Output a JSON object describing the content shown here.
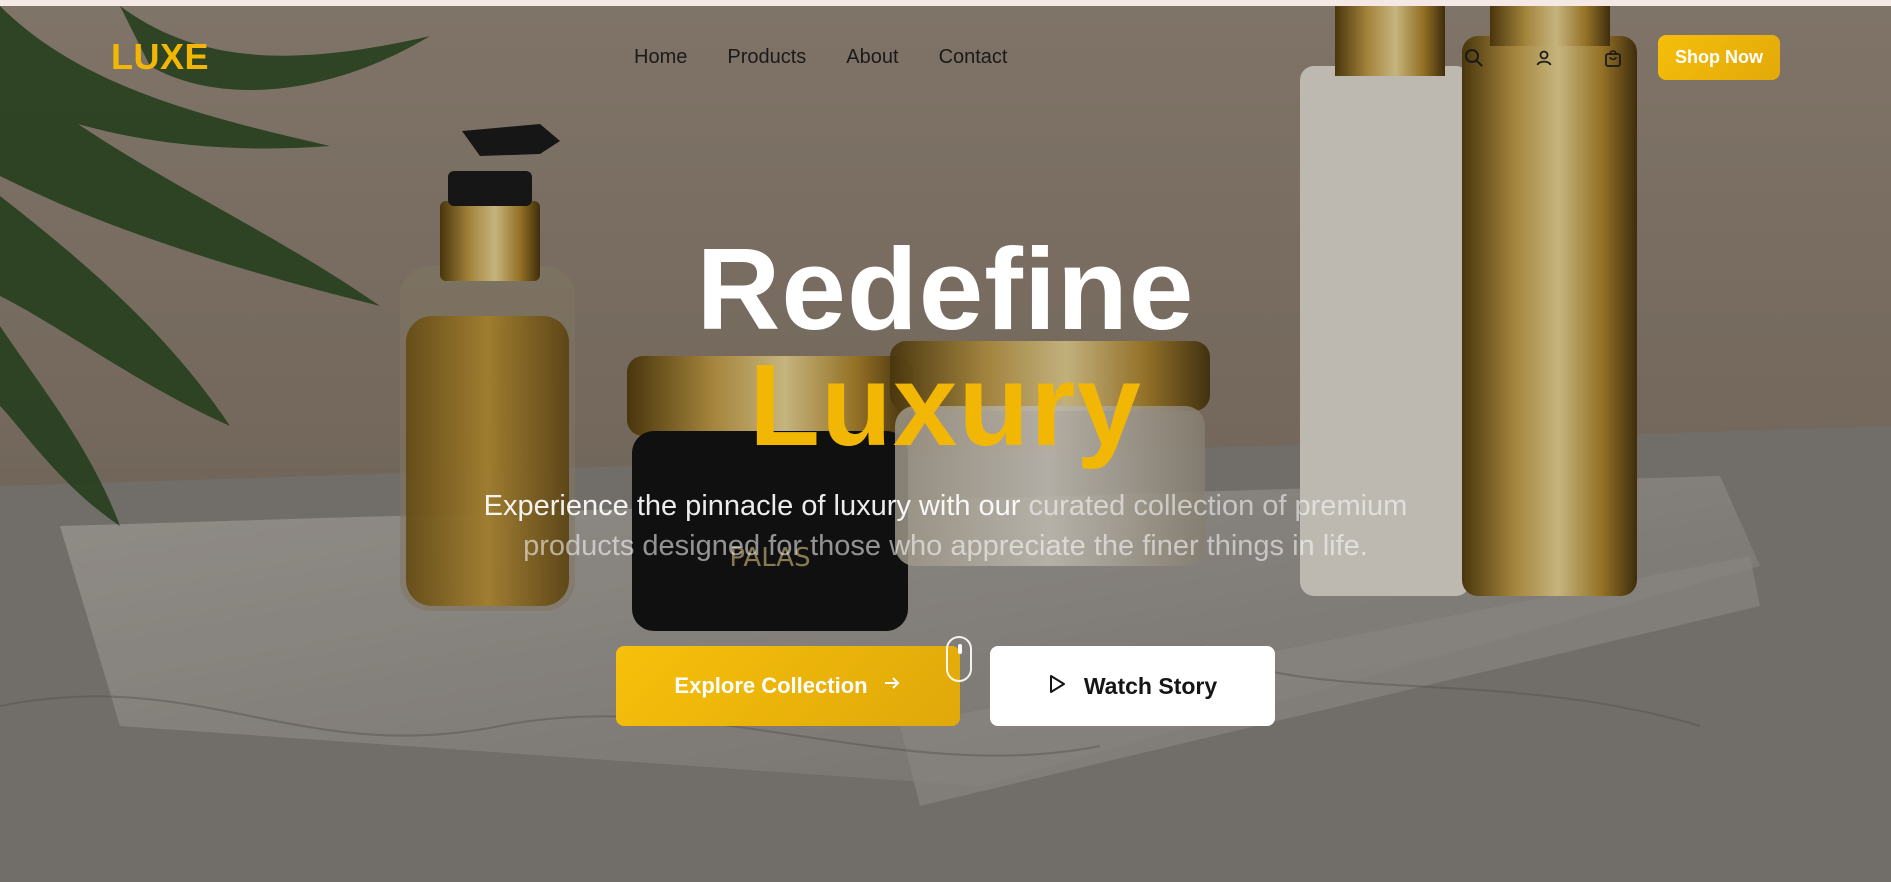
{
  "brand": {
    "logo": "LUXE",
    "accent": "#f2b705"
  },
  "nav": {
    "links": [
      "Home",
      "Products",
      "About",
      "Contact"
    ],
    "icons": [
      "search-icon",
      "user-icon",
      "shopping-bag-icon"
    ],
    "cta_label": "Shop Now"
  },
  "hero": {
    "title_line1": "Redefine",
    "title_line2": "Luxury",
    "subtitle_bright": "Experience the pinnacle of luxury with our",
    "subtitle_dim": " curated collection of premium products designed for those who appreciate the finer things in life.",
    "primary_button": "Explore Collection",
    "primary_icon": "arrow-right-icon",
    "secondary_button": "Watch Story",
    "secondary_icon": "play-icon",
    "scroll_icon": "mouse-scroll-icon"
  }
}
